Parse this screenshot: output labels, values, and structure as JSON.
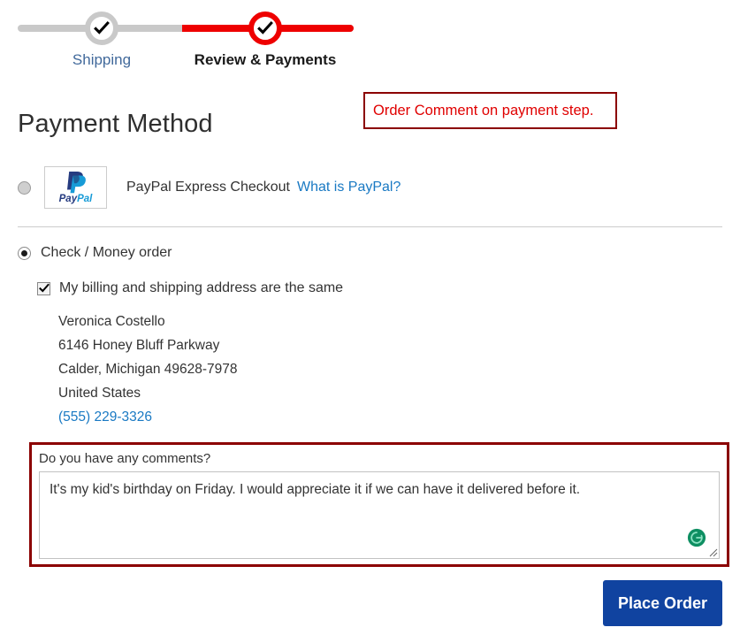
{
  "checkout": {
    "progress": {
      "steps": [
        {
          "label": "Shipping",
          "state": "complete",
          "icon": "check-icon"
        },
        {
          "label": "Review & Payments",
          "state": "active",
          "icon": "check-icon"
        }
      ],
      "complete_color": "#c9c9c9",
      "active_color": "#ee0000"
    },
    "annotation": {
      "text": "Order Comment on payment step.",
      "text_color": "#e00000",
      "border_color": "#8b0000"
    },
    "page_title": "Payment Method",
    "methods": [
      {
        "id": "paypal",
        "label": "PayPal Express Checkout",
        "link_label": "What is PayPal?",
        "link_color": "#1979c3",
        "logo_text": "PayPal",
        "logo_icon": "paypal-logo-icon",
        "selected": false
      },
      {
        "id": "checkmo",
        "label": "Check / Money order",
        "selected": true
      }
    ],
    "billing": {
      "same_as_shipping_label": "My billing and shipping address are the same",
      "checked": true,
      "address": {
        "name": "Veronica Costello",
        "street": "6146 Honey Bluff Parkway",
        "city_state_zip": "Calder, Michigan 49628-7978",
        "country": "United States",
        "phone": "(555) 229-3326"
      }
    },
    "comment": {
      "label": "Do you have any comments?",
      "value": "It's my kid's birthday on Friday. I would appreciate it if we can have it delivered before it.",
      "placeholder": "",
      "highlight_color": "#8b0000",
      "assistant_icon": "grammarly-icon",
      "assistant_color": "#15a37f",
      "resize_handle_icon": "resize-handle-icon"
    },
    "actions": {
      "place_order_label": "Place Order",
      "place_order_color": "#1043a0"
    }
  }
}
